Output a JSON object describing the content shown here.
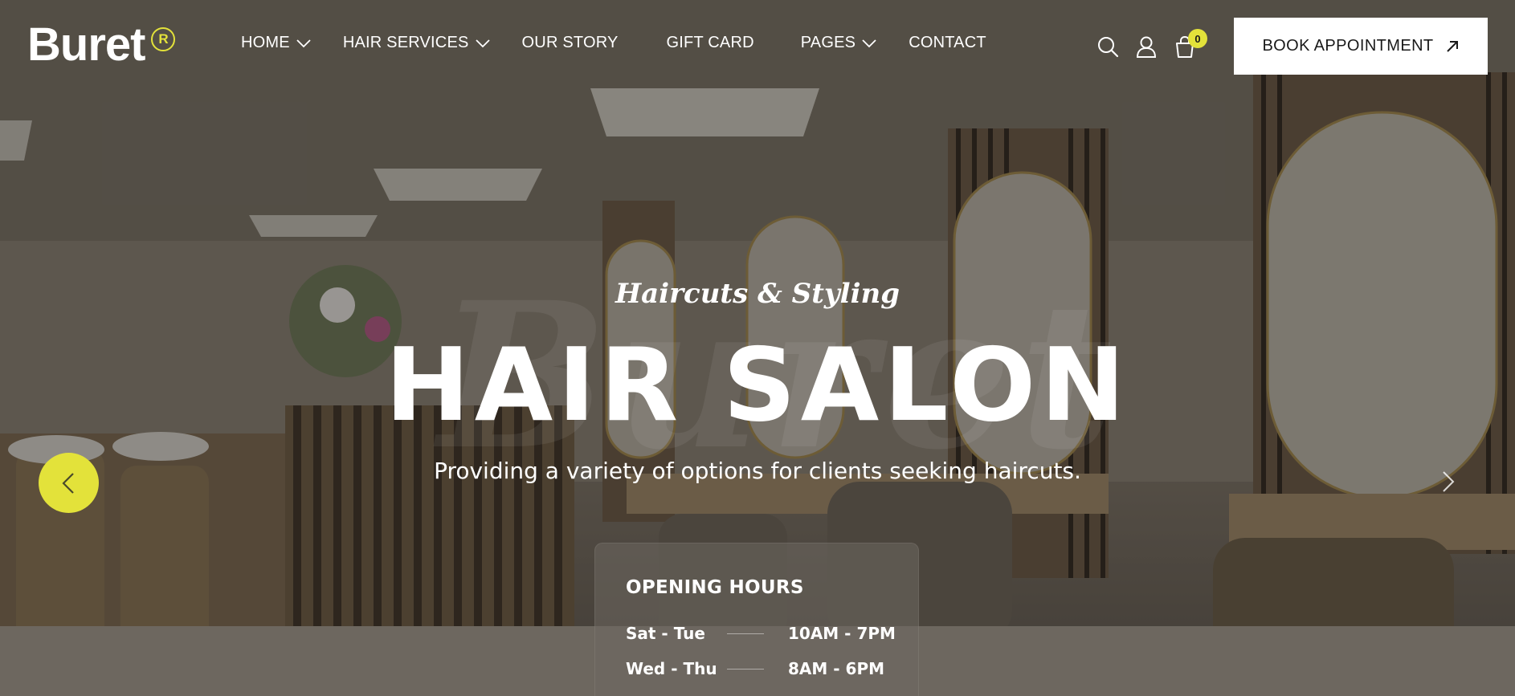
{
  "brand": {
    "name": "Buret",
    "mark": "R",
    "accent_color": "#e3e23a"
  },
  "nav": {
    "items": [
      {
        "label": "HOME",
        "has_dropdown": true
      },
      {
        "label": "HAIR SERVICES",
        "has_dropdown": true
      },
      {
        "label": "OUR STORY",
        "has_dropdown": false
      },
      {
        "label": "GIFT CARD",
        "has_dropdown": false
      },
      {
        "label": "PAGES",
        "has_dropdown": true
      },
      {
        "label": "CONTACT",
        "has_dropdown": false
      }
    ]
  },
  "header_icons": [
    "search-icon",
    "user-icon",
    "cart-icon"
  ],
  "cart": {
    "count": "0"
  },
  "cta": {
    "label": "BOOK APPOINTMENT",
    "icon": "arrow-up-right-icon"
  },
  "hero": {
    "subtitle": "Haircuts & Styling",
    "headline": "HAIR SALON",
    "tagline": "Providing a variety of options for clients seeking haircuts.",
    "watermark": "Buret"
  },
  "slider": {
    "prev_icon": "chevron-left-icon",
    "next_icon": "chevron-right-icon"
  },
  "hours": {
    "title": "OPENING HOURS",
    "rows": [
      {
        "day": "Sat - Tue",
        "time": "10AM - 7PM"
      },
      {
        "day": "Wed - Thu",
        "time": "8AM - 6PM"
      }
    ]
  }
}
